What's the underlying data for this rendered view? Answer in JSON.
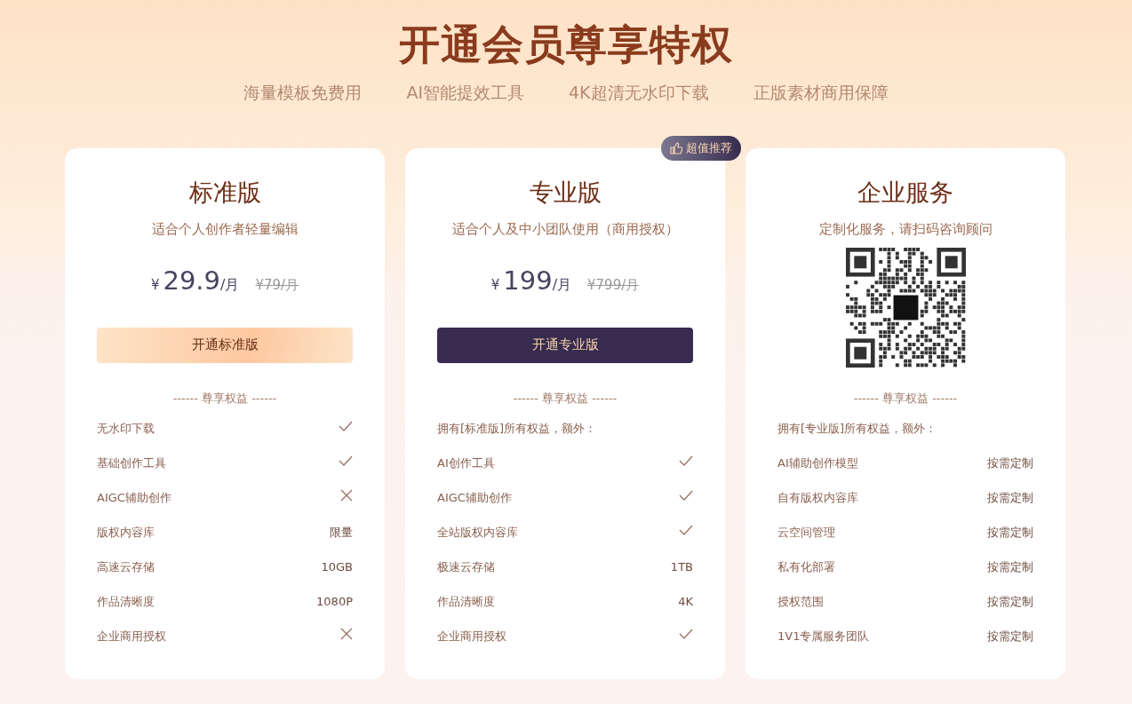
{
  "title": "开通会员尊享特权",
  "highlights": [
    "海量模板免费用",
    "AI智能提效工具",
    "4K超清无水印下载",
    "正版素材商用保障"
  ],
  "plans": [
    {
      "name": "标准版",
      "description": "适合个人创作者轻量编辑",
      "kind": "price",
      "currency": "¥",
      "price": "29.9",
      "unit": "/月",
      "original_price": "¥79/月",
      "button": "开通标准版",
      "divider": "------ 尊享权益 ------",
      "features": [
        {
          "kind": "check",
          "label": "无水印下载"
        },
        {
          "kind": "check",
          "label": "基础创作工具"
        },
        {
          "kind": "cross",
          "label": "AIGC辅助创作"
        },
        {
          "kind": "text",
          "label": "版权内容库",
          "value": "限量"
        },
        {
          "kind": "text",
          "label": "高速云存储",
          "value": "10GB"
        },
        {
          "kind": "text",
          "label": "作品清晰度",
          "value": "1080P"
        },
        {
          "kind": "cross",
          "label": "企业商用授权"
        }
      ]
    },
    {
      "name": "专业版",
      "badge": "超值推荐",
      "description": "适合个人及中小团队使用（商用授权）",
      "kind": "price",
      "currency": "¥",
      "price": "199",
      "unit": "/月",
      "original_price": "¥799/月",
      "button": "开通专业版",
      "divider": "------ 尊享权益 ------",
      "features": [
        {
          "kind": "note",
          "label": "拥有[标准版]所有权益，额外："
        },
        {
          "kind": "check",
          "label": "AI创作工具"
        },
        {
          "kind": "check",
          "label": "AIGC辅助创作"
        },
        {
          "kind": "check",
          "label": "全站版权内容库"
        },
        {
          "kind": "text",
          "label": "极速云存储",
          "value": "1TB"
        },
        {
          "kind": "text",
          "label": "作品清晰度",
          "value": "4K"
        },
        {
          "kind": "check",
          "label": "企业商用授权"
        }
      ]
    },
    {
      "name": "企业服务",
      "description": "定制化服务，请扫码咨询顾问",
      "kind": "qr",
      "divider": "------ 尊享权益 ------",
      "features": [
        {
          "kind": "note",
          "label": "拥有[专业版]所有权益，额外："
        },
        {
          "kind": "text",
          "label": "AI辅助创作模型",
          "value": "按需定制"
        },
        {
          "kind": "text",
          "label": "自有版权内容库",
          "value": "按需定制"
        },
        {
          "kind": "text",
          "label": "云空间管理",
          "value": "按需定制"
        },
        {
          "kind": "text",
          "label": "私有化部署",
          "value": "按需定制"
        },
        {
          "kind": "text",
          "label": "授权范围",
          "value": "按需定制"
        },
        {
          "kind": "text",
          "label": "1V1专属服务团队",
          "value": "按需定制"
        }
      ]
    }
  ]
}
